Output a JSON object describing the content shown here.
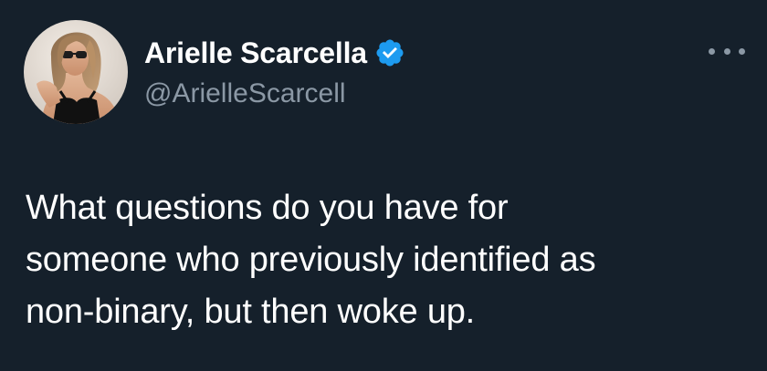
{
  "author": {
    "display_name": "Arielle Scarcella",
    "handle": "@ArielleScarcell",
    "verified": true,
    "verified_color": "#1d9bf0"
  },
  "tweet": {
    "text_lines": [
      "What questions do you have for",
      "someone who previously identified as",
      "non-binary, but then woke up."
    ]
  },
  "icons": {
    "more": "more-options-icon",
    "verified": "verified-badge-icon"
  },
  "colors": {
    "background": "#15202b",
    "text_primary": "#ffffff",
    "text_secondary": "#8b98a5"
  }
}
